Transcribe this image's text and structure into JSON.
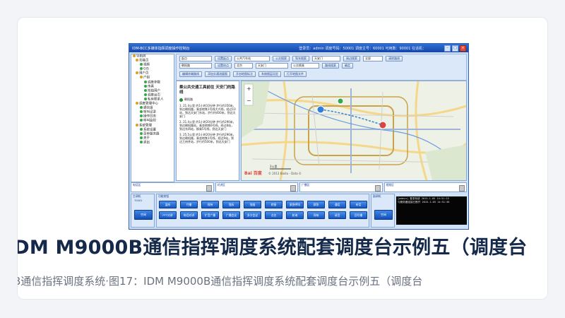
{
  "card": {
    "title": "IDM M9000B通信指挥调度系统配套调度台示例五（调度台",
    "caption": "B通信指挥调度系统·图17：IDM M9000B通信指挥调度系统配套调度台示例五（调度台"
  },
  "screenshot": {
    "window_title": "IDM-BCC多媒体指挥调度操作控制台",
    "window_info": "登录员：admin  调度号码：50001  调度主号：60001  可用数：90001  在话机：",
    "tree": [
      "导航树",
      "功能页",
      "视频",
      "GIS",
      "用户页",
      "户组",
      "调度参数",
      "传真",
      "抢拍用户",
      "调度台页",
      "私有联系人",
      "调度管理中心",
      "通信组",
      "呼叫记录",
      "操作日志",
      "呼叫监控",
      "系统管理",
      "系统设置",
      "菜单服务器",
      "关于",
      "退出"
    ],
    "toolbar": {
      "sel_from": "起点",
      "btn_from": "设置起点",
      "sel_mode": "公共汽车站",
      "btn_bus": "公交搜索",
      "btn_drive": "驾车搜索",
      "sel_to": "天安门",
      "btn_nearby": "周边搜索",
      "sel_scope": "全部",
      "btn_clear": "清除路线",
      "sel_name": "朝阳路",
      "btn_to": "设置终点",
      "sel_city": "北京",
      "sel_dest": "天安门",
      "sel_type": "公交换乘",
      "btn_route": "路线搜索",
      "btn_ok": "确定",
      "btn_edit_path": "编辑终端路线",
      "btn_add_route": "添加交通流量图",
      "btn_mark": "开启地图标注",
      "btn_layers": "系统图层设定",
      "btn_open": "打开地图文件"
    },
    "route": {
      "heading": "乘公共交通工具前往 天安门的路线",
      "start_label": "朝阳路",
      "segments": [
        "1. 21.4公里 约1小时10分钟 步行约350米，到达朝阳路，乘坐地铁1号线大兴线，经过10站，到达天安门东站，步行约400米，到达天安门",
        "2. 21.4公里 约1小时20分钟 步行约290米，到达朝阳路站，乘坐地铁6号线，经过8站，到达东四站，换乘5号线，到达天安门",
        "3. 25.5公里 约1小时20分钟 步行约290米，到达朝阳路，乘坐地铁1号线，经过9站，到达王府井站，步行约500米，到达天安门"
      ]
    },
    "map": {
      "copyright": "© 2013 Baidu - Data ©",
      "scale": "2公里",
      "logo": "Bai 百度"
    },
    "panels": [
      "电话区",
      "对讲区",
      "广播区",
      "视频区"
    ],
    "bottom": {
      "left_label": "主调机",
      "left_sub": "70001",
      "left_btn": "空闲",
      "fn_label": "功能按钮",
      "fn_buttons": [
        [
          "监听",
          "代播",
          "保持",
          "强拆",
          "强插",
          "转接",
          "紧急呼叫",
          "群答",
          "通话",
          "听话"
        ],
        [
          "PTT对讲",
          "电话对讲",
          "扩音广播",
          "广播会议",
          "多方会议",
          "点名",
          "轮询",
          "同响",
          "录音",
          "回号播"
        ]
      ],
      "right_label": "副调机",
      "right_btn": "空闲",
      "log_lines": [
        "[admin] 登录系统  2015-1-05 14:51:15",
        "与服务器连接已断开  2015-1-05 14:51:36"
      ]
    }
  }
}
